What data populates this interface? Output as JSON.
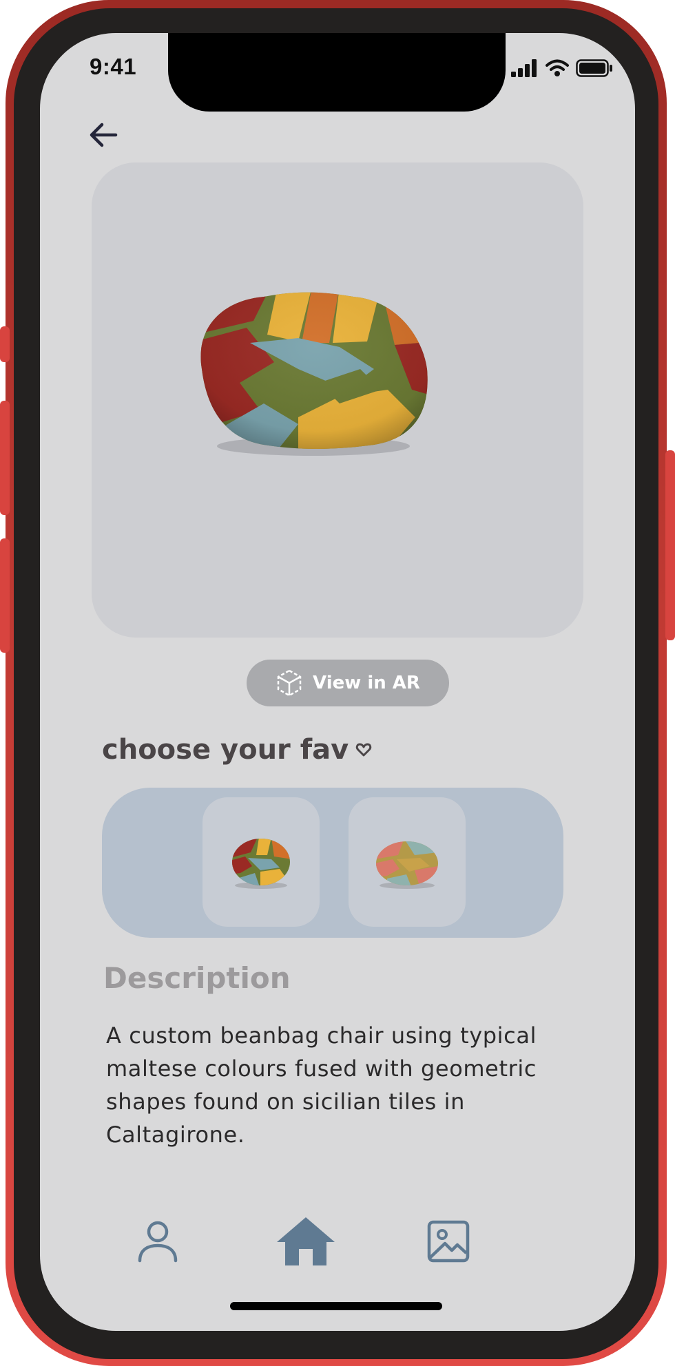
{
  "status_bar": {
    "time": "9:41",
    "icons": [
      "signal-icon",
      "wifi-icon",
      "battery-icon"
    ]
  },
  "header": {
    "back_icon": "arrow-left-icon"
  },
  "product": {
    "image": "beanbag-chair-image",
    "ar_button_label": "View in AR",
    "ar_icon": "cube-ar-icon"
  },
  "variants": {
    "title": "choose your fav",
    "title_icon": "heart-icon",
    "items": [
      {
        "name": "beanbag-variant-1"
      },
      {
        "name": "beanbag-variant-2"
      }
    ]
  },
  "description": {
    "title": "Description",
    "text": "A custom beanbag chair using typical maltese colours fused with geometric shapes found on sicilian tiles in Caltagirone."
  },
  "bottom_nav": {
    "items": [
      "user-icon",
      "home-icon",
      "image-icon"
    ],
    "active": "home-icon"
  },
  "colors": {
    "frame": "#d8443f",
    "screen_bg": "#d9d9da",
    "hero_bg": "#cdced2",
    "variants_bg": "#b5c0cd",
    "nav_icon": "#5f7a92",
    "beanbag_red": "#9a2a24",
    "beanbag_green": "#6b7a34",
    "beanbag_blue": "#7aa3ad",
    "beanbag_yellow": "#e9b23a",
    "beanbag_orange": "#d2702a"
  }
}
